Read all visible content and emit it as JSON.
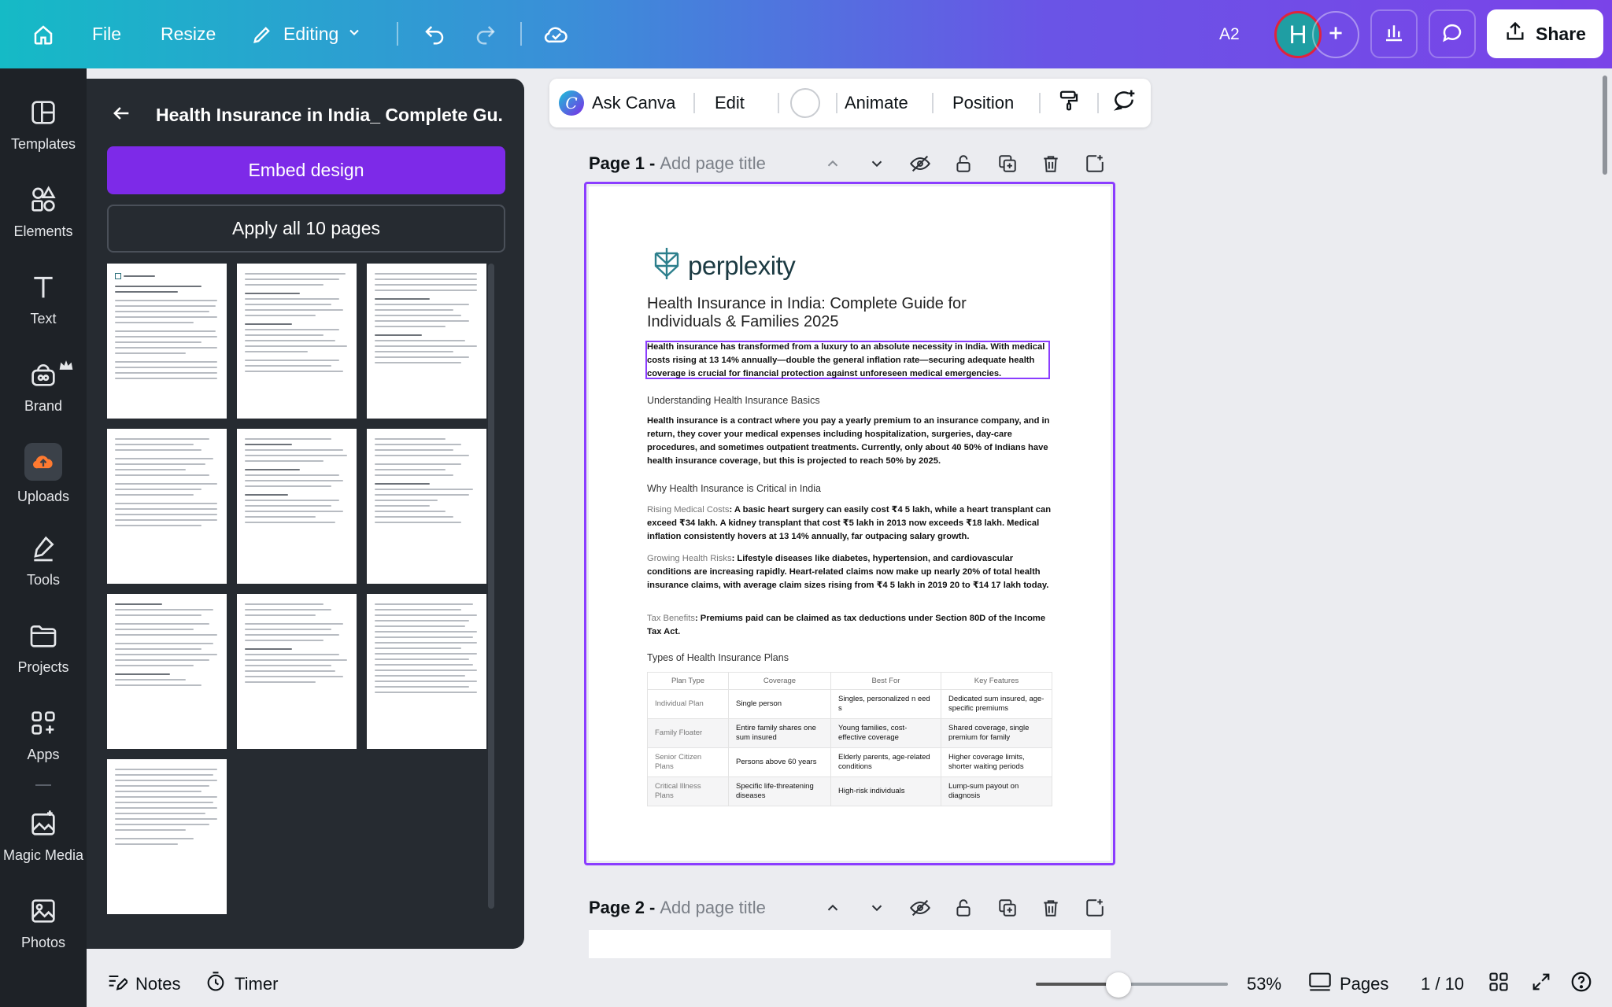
{
  "topbar": {
    "file": "File",
    "resize": "Resize",
    "editing": "Editing",
    "a2": "A2",
    "avatar_initial": "H",
    "share": "Share"
  },
  "rail": {
    "items": [
      {
        "label": "Templates"
      },
      {
        "label": "Elements"
      },
      {
        "label": "Text"
      },
      {
        "label": "Brand"
      },
      {
        "label": "Uploads"
      },
      {
        "label": "Tools"
      },
      {
        "label": "Projects"
      },
      {
        "label": "Apps"
      },
      {
        "label": "Magic Media"
      },
      {
        "label": "Photos"
      }
    ]
  },
  "panel": {
    "title": "Health Insurance in India_ Complete Gu...",
    "embed": "Embed design",
    "apply": "Apply all 10 pages"
  },
  "ctx": {
    "ask_canva": "Ask Canva",
    "edit": "Edit",
    "animate": "Animate",
    "position": "Position"
  },
  "pages": {
    "page1_label": "Page 1 -",
    "page2_label": "Page 2 -",
    "add_title": "Add page title"
  },
  "doc": {
    "logo": "perplexity",
    "title": "Health Insurance in India: Complete Guide for Individuals & Families  2025",
    "intro": "Health insurance has transformed from a luxury to an absolute necessity in India. With medical costs rising at 13 14% annually—double the general inflation rate—securing adequate health coverage is crucial for financial protection against unforeseen medical emergencies.",
    "h_basics": "Understanding Health Insurance Basics",
    "basics": "Health insurance is a contract where you pay a yearly premium to an insurance company, and in return, they cover your medical expenses including hospitalization, surgeries, day-care procedures, and sometimes outpatient treatments. Currently, only about 40 50% of Indians have health insurance coverage, but this is projected to reach 50% by 2025.",
    "h_why": "Why Health Insurance is Critical in India",
    "rising_label": "Rising Medical Costs",
    "rising": ": A basic heart surgery can easily cost ₹4 5 lakh, while a heart transplant can exceed ₹34 lakh. A kidney transplant that cost ₹5 lakh in 2013 now exceeds ₹18 lakh. Medical inflation consistently hovers at 13 14% annually, far outpacing salary growth.",
    "growing_label": "Growing Health Risks",
    "growing": ": Lifestyle diseases like diabetes, hypertension, and cardiovascular conditions are increasing rapidly. Heart-related claims now make up nearly 20% of total health insurance claims, with average claim sizes rising from ₹4 5 lakh in 2019 20 to ₹14 17 lakh today.",
    "tax_label": "Tax Benefits",
    "tax": ": Premiums paid can be claimed as tax deductions under Section 80D of the Income Tax Act.",
    "h_types": "Types of Health Insurance Plans",
    "table": {
      "headers": [
        "Plan Type",
        "Coverage",
        "Best For",
        "Key Features"
      ],
      "rows": [
        [
          "Individual Plan",
          "Single person",
          "Singles, personalized n eed s",
          "Dedicated sum insured, age-specific premiums"
        ],
        [
          "Family Floater",
          "Entire family shares one sum insured",
          "Young families, cost-effective coverage",
          "Shared coverage, single premium for family"
        ],
        [
          "Senior Citizen Plans",
          "Persons above 60 years",
          "Elderly parents, age-related conditions",
          "Higher coverage limits, shorter waiting periods"
        ],
        [
          "Critical Illness Plans",
          "Specific life-threatening diseases",
          "High-risk individuals",
          "Lump-sum payout on diagnosis"
        ]
      ]
    }
  },
  "bottom": {
    "notes": "Notes",
    "timer": "Timer",
    "zoom": "53%",
    "zoom_level": 0.43,
    "pages": "Pages",
    "page_count": "1 / 10"
  }
}
